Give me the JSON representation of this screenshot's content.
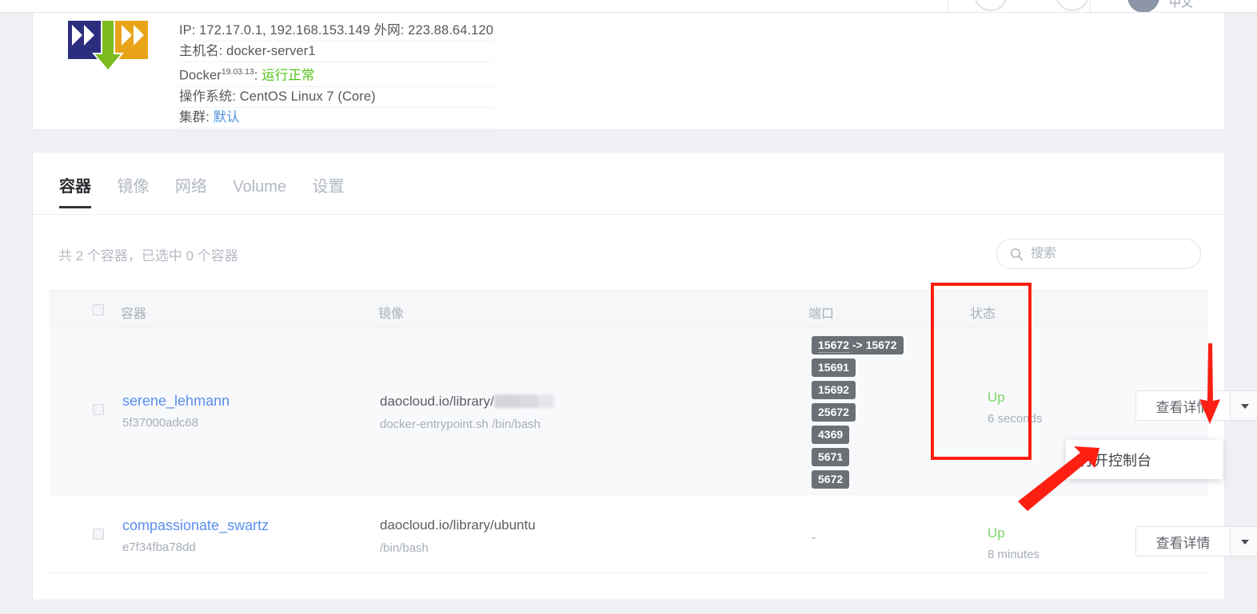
{
  "topbar": {
    "lang_label": "中文",
    "gauge_count": 2,
    "avatar": "user-avatar"
  },
  "host": {
    "logo": "daocloud-logo",
    "ip_label": "IP:",
    "ip_value": "172.17.0.1, 192.168.153.149",
    "wan_label": "外网:",
    "wan_value": "223.88.64.120",
    "hostname_label": "主机名:",
    "hostname_value": "docker-server1",
    "docker_label": "Docker",
    "docker_version": "19.03.13",
    "docker_status": "运行正常",
    "os_label": "操作系统:",
    "os_value": "CentOS Linux 7 (Core)",
    "cluster_label": "集群:",
    "cluster_value": "默认"
  },
  "tabs": [
    {
      "label": "容器",
      "active": true
    },
    {
      "label": "镜像",
      "active": false
    },
    {
      "label": "网络",
      "active": false
    },
    {
      "label": "Volume",
      "active": false
    },
    {
      "label": "设置",
      "active": false
    }
  ],
  "toolbar": {
    "count_text": "共 2 个容器，已选中 0 个容器",
    "search_placeholder": "搜索",
    "search_value": ""
  },
  "table": {
    "headers": [
      "容器",
      "镜像",
      "端口",
      "状态"
    ],
    "rows": [
      {
        "name": "serene_lehmann",
        "id": "5f37000adc68",
        "image_prefix": "daocloud.io/library/",
        "image_redacted": true,
        "command": "docker-entrypoint.sh /bin/bash",
        "ports": [
          {
            "text": "15672 -> 15672",
            "mapped": true,
            "from": "15672",
            "arrow": "->",
            "to": "15672"
          },
          {
            "text": "15691",
            "mapped": false
          },
          {
            "text": "15692",
            "mapped": false
          },
          {
            "text": "25672",
            "mapped": false
          },
          {
            "text": "4369",
            "mapped": false
          },
          {
            "text": "5671",
            "mapped": false
          },
          {
            "text": "5672",
            "mapped": false
          }
        ],
        "ports_dash": "",
        "status": "Up",
        "status_time": "6 seconds",
        "detail_button": "查看详情"
      },
      {
        "name": "compassionate_swartz",
        "id": "e7f34fba78dd",
        "image_prefix": "daocloud.io/library/ubuntu",
        "image_redacted": false,
        "command": "/bin/bash",
        "ports": [],
        "ports_dash": "-",
        "status": "Up",
        "status_time": "8 minutes",
        "detail_button": "查看详情"
      }
    ]
  },
  "dropdown": {
    "items": [
      "打开控制台"
    ]
  },
  "annotations": {
    "highlight_color": "#fc1f12",
    "rect_target": "状态",
    "arrow_down_target": "dropdown-caret",
    "arrow_diag_target": "打开控制台"
  },
  "colors": {
    "page_bg": "#eef0f4",
    "card_bg": "#ffffff",
    "link": "#5b8def",
    "status_up": "#7ed06b",
    "port_tag": "#6b6f76",
    "annotation": "#fc1f12"
  }
}
